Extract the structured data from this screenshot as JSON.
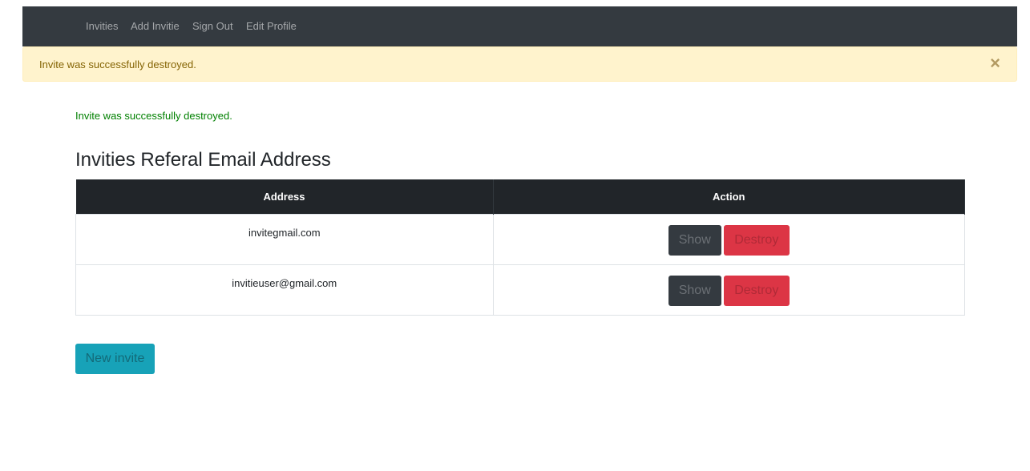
{
  "nav": {
    "items": [
      {
        "label": "Invities"
      },
      {
        "label": "Add Invitie"
      },
      {
        "label": "Sign Out"
      },
      {
        "label": "Edit Profile"
      }
    ]
  },
  "alert": {
    "text": "Invite was successfully destroyed.",
    "close": "×"
  },
  "notice": "Invite was successfully destroyed.",
  "title": "Invities Referal Email Address",
  "table": {
    "headers": {
      "address": "Address",
      "action": "Action"
    },
    "rows": [
      {
        "address": "invitegmail.com",
        "show": "Show",
        "destroy": "Destroy"
      },
      {
        "address": "invitieuser@gmail.com",
        "show": "Show",
        "destroy": "Destroy"
      }
    ]
  },
  "new_invite_label": "New invite",
  "colors": {
    "navbar": "#343a40",
    "alert_bg": "#fff3cd",
    "notice_text": "#008000",
    "table_header": "#212529",
    "show_button": "#343a40",
    "destroy_button": "#dc3545",
    "new_button": "#17a2b8"
  }
}
